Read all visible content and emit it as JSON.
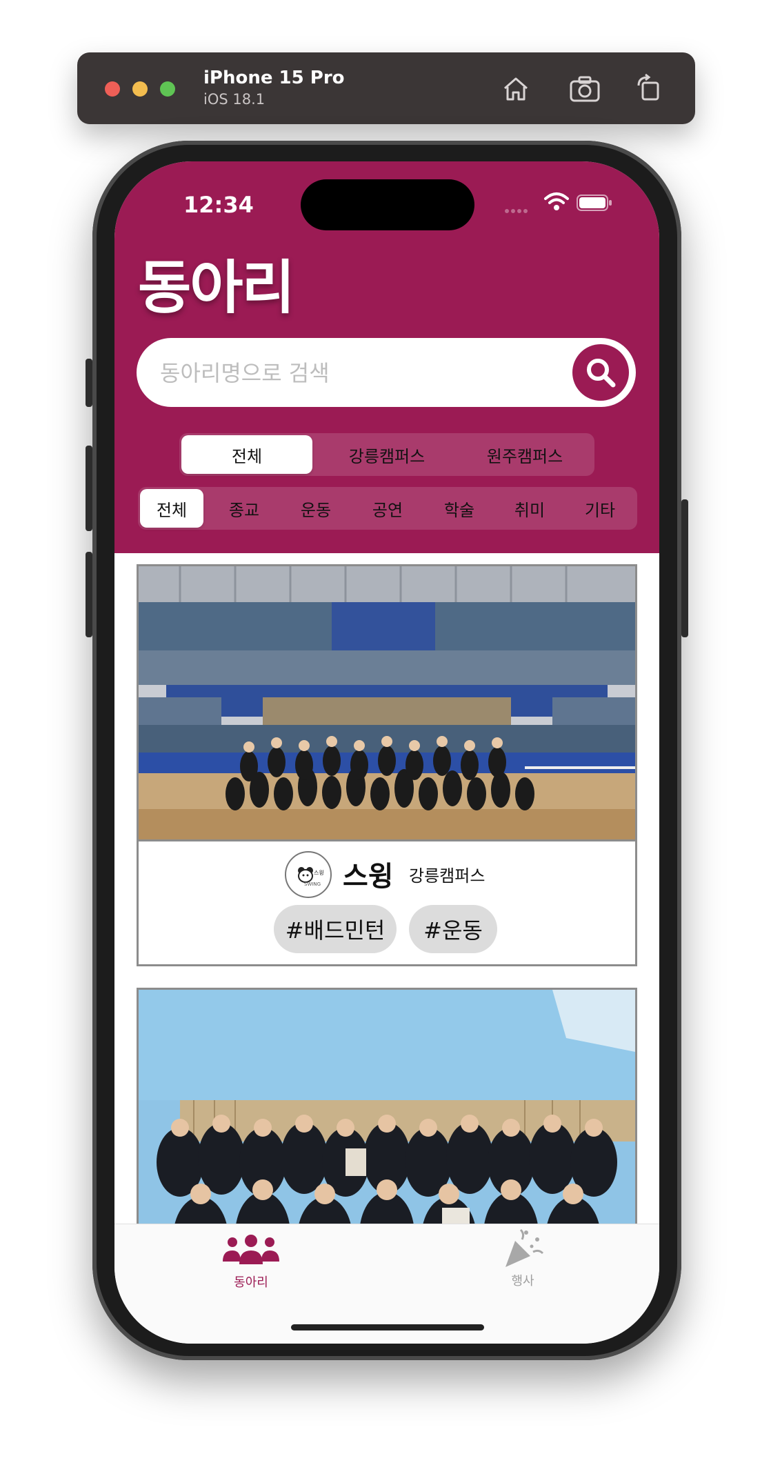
{
  "simulator": {
    "device": "iPhone 15 Pro",
    "os": "iOS 18.1",
    "icons": [
      "home-icon",
      "screenshot-icon",
      "rotate-icon"
    ]
  },
  "status_bar": {
    "time": "12:34",
    "icons": [
      "wifi-icon",
      "battery-icon"
    ]
  },
  "header": {
    "title": "동아리",
    "background_color": "#9b1b54"
  },
  "search": {
    "placeholder": "동아리명으로 검색",
    "value": ""
  },
  "campus_filter": {
    "options": [
      "전체",
      "강릉캠퍼스",
      "원주캠퍼스"
    ],
    "selected": "전체"
  },
  "category_filter": {
    "options": [
      "전체",
      "종교",
      "운동",
      "공연",
      "학술",
      "취미",
      "기타"
    ],
    "selected": "전체"
  },
  "clubs": [
    {
      "name": "스윙",
      "campus": "강릉캠퍼스",
      "logo_text": "스윙 SWING",
      "tags": [
        "#배드민턴",
        "#운동"
      ]
    },
    {
      "name": "",
      "campus": "",
      "tags": []
    }
  ],
  "tab_bar": {
    "items": [
      {
        "label": "동아리",
        "icon": "people-group-icon",
        "active": true
      },
      {
        "label": "행사",
        "icon": "party-popper-icon",
        "active": false
      }
    ],
    "active_color": "#9b1b54",
    "inactive_color": "#9e9e9e"
  }
}
